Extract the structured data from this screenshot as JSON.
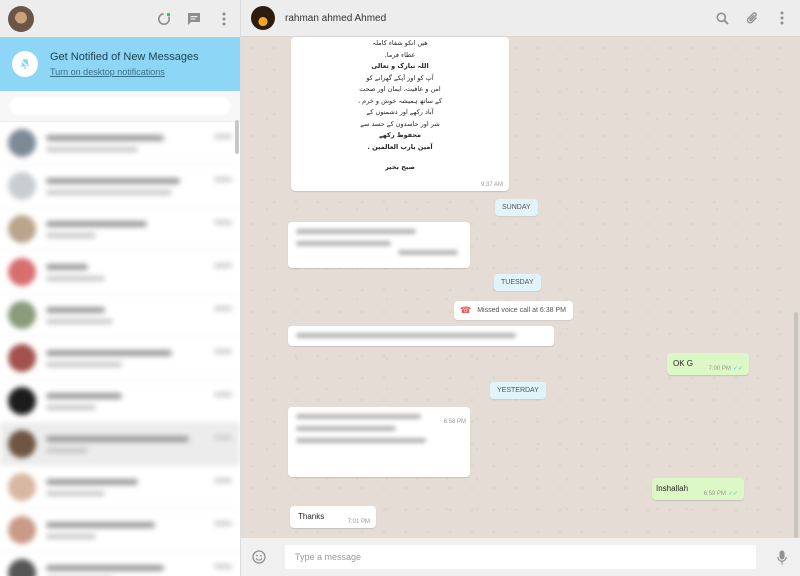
{
  "colors": {
    "accent": "#8ed6f5",
    "outgoing": "#dcf8c6",
    "chat_bg": "#e5ddd5",
    "missed_call": "#e05c5c",
    "read_ticks": "#4fc3f7"
  },
  "left_header": {
    "icons": [
      "status-icon",
      "new-chat-icon",
      "menu-icon"
    ]
  },
  "notification": {
    "title": "Get Notified of New Messages",
    "link": "Turn on desktop notifications",
    "icon": "bell-off-icon"
  },
  "chat_list_rows": 11,
  "chat_header": {
    "name": "rahman ahmed Ahmed",
    "icons": [
      "search-icon",
      "attach-icon",
      "menu-icon"
    ]
  },
  "messages": {
    "urdu_card": {
      "lines": [
        "ھیں انکو شفاء کاملہ",
        "عطاء فرما.",
        "اللہ تبارک و تعالی",
        "آپ کو اور آپکے گھرانے کو",
        "امن و عافیت، ایمان اور صحت",
        "کے ساتھ ہمیشہ خوش و خرم ،",
        "آباد رکھے اور دشمنوں کے",
        "شر اور حاسدوں کے حسد سے",
        "محفوظ رکھے",
        "آمین یارب العالمین ."
      ],
      "greeting": "صبح بخیر",
      "time": "9:37 AM"
    },
    "day_sunday": "SUNDAY",
    "day_tuesday": "TUESDAY",
    "missed_call": "Missed voice call at 6:38 PM",
    "ok_g": {
      "text": "OK G",
      "time": "7:00 PM"
    },
    "day_yesterday": "YESTERDAY",
    "blurred_time": "6:58 PM",
    "inshallah": {
      "text": "Inshallah",
      "time": "6:59 PM"
    },
    "thanks": {
      "text": "Thanks",
      "time": "7:01 PM"
    }
  },
  "composer": {
    "placeholder": "Type a message"
  }
}
